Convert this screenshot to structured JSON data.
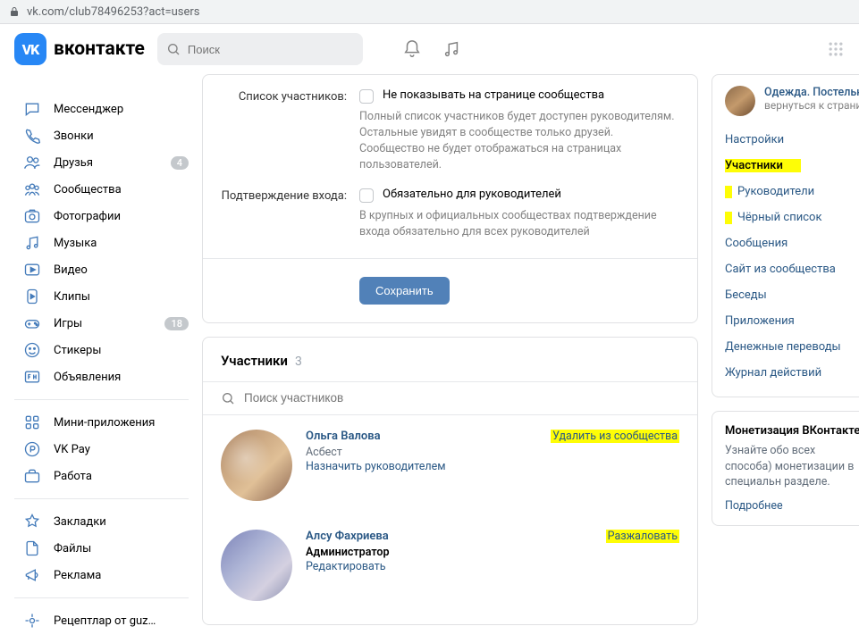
{
  "addr": {
    "url": "vk.com/club78496253?act=users"
  },
  "header": {
    "brand": "вконтакте",
    "logo": "VK",
    "search_placeholder": "Поиск"
  },
  "nav": {
    "items": [
      {
        "label": "Мессенджер",
        "icon": "message"
      },
      {
        "label": "Звонки",
        "icon": "phone"
      },
      {
        "label": "Друзья",
        "icon": "friends",
        "badge": "4"
      },
      {
        "label": "Сообщества",
        "icon": "communities"
      },
      {
        "label": "Фотографии",
        "icon": "photo"
      },
      {
        "label": "Музыка",
        "icon": "music"
      },
      {
        "label": "Видео",
        "icon": "video"
      },
      {
        "label": "Клипы",
        "icon": "clips"
      },
      {
        "label": "Игры",
        "icon": "games",
        "badge": "18"
      },
      {
        "label": "Стикеры",
        "icon": "stickers"
      },
      {
        "label": "Объявления",
        "icon": "ads"
      }
    ],
    "items2": [
      {
        "label": "Мини-приложения",
        "icon": "mini"
      },
      {
        "label": "VK Pay",
        "icon": "pay"
      },
      {
        "label": "Работа",
        "icon": "work"
      }
    ],
    "items3": [
      {
        "label": "Закладки",
        "icon": "bookmark"
      },
      {
        "label": "Файлы",
        "icon": "files"
      },
      {
        "label": "Реклама",
        "icon": "promo"
      }
    ],
    "items4": [
      {
        "label": "Рецептлар от guz…",
        "icon": "recipe"
      }
    ]
  },
  "settings": {
    "member_list": {
      "label": "Список участников:",
      "checkbox_label": "Не показывать на странице сообщества",
      "hint": "Полный список участников будет доступен руководителям. Остальные увидят в сообществе только друзей. Сообщество не будет отображаться на страницах пользователей."
    },
    "verify": {
      "label": "Подтверждение входа:",
      "checkbox_label": "Обязательно для руководителей",
      "hint": "В крупных и официальных сообществах подтверждение входа обязательно для всех руководителей"
    },
    "save": "Сохранить"
  },
  "members": {
    "title": "Участники",
    "count": "3",
    "search_placeholder": "Поиск участников",
    "list": [
      {
        "name": "Ольга Валова",
        "sub": "Асбест",
        "link": "Назначить руководителем",
        "action": "Удалить из сообщества"
      },
      {
        "name": "Алсу Фахриева",
        "sub": "Администратор",
        "link": "Редактировать",
        "action": "Разжаловать"
      }
    ]
  },
  "right": {
    "community": {
      "title": "Одежда. Постельно",
      "sub": "вернуться к страни"
    },
    "menu": [
      {
        "label": "Настройки"
      },
      {
        "label": "Участники",
        "active": true
      },
      {
        "label": "Руководители",
        "mark": true
      },
      {
        "label": "Чёрный список",
        "mark": true
      },
      {
        "label": "Сообщения"
      },
      {
        "label": "Сайт из сообщества"
      },
      {
        "label": "Беседы"
      },
      {
        "label": "Приложения"
      },
      {
        "label": "Денежные переводы"
      },
      {
        "label": "Журнал действий"
      }
    ],
    "mon": {
      "title": "Монетизация ВКонтакте",
      "text": "Узнайте обо всех способа) монетизации в специальн разделе.",
      "link": "Подробнее"
    }
  }
}
